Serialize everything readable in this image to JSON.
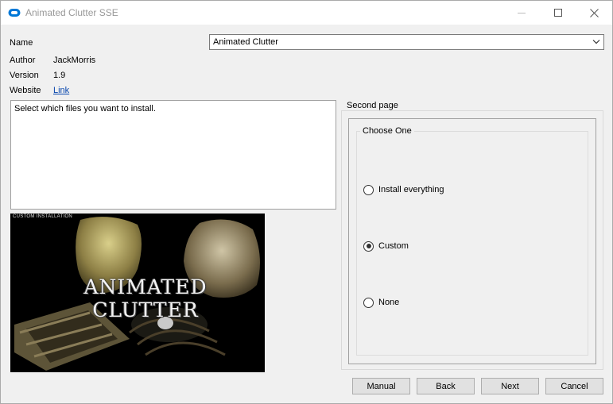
{
  "window": {
    "title": "Animated Clutter SSE",
    "icon": "cloud-logo-icon"
  },
  "colors": {
    "accent": "#0078d7",
    "link": "#0645ad"
  },
  "info": {
    "name_label": "Name",
    "name_value": "Animated Clutter",
    "author_label": "Author",
    "author_value": "JackMorris",
    "version_label": "Version",
    "version_value": "1.9",
    "website_label": "Website",
    "website_link": "Link"
  },
  "description": "Select which files you want to install.",
  "image": {
    "caption": "CUSTOM INSTALLATION",
    "title": "ANIMATED CLUTTER"
  },
  "page": {
    "title": "Second page",
    "group_title": "Choose One",
    "options": [
      {
        "label": "Install everything",
        "selected": false
      },
      {
        "label": "Custom",
        "selected": true
      },
      {
        "label": "None",
        "selected": false
      }
    ]
  },
  "buttons": {
    "manual": "Manual",
    "back": "Back",
    "next": "Next",
    "cancel": "Cancel"
  }
}
